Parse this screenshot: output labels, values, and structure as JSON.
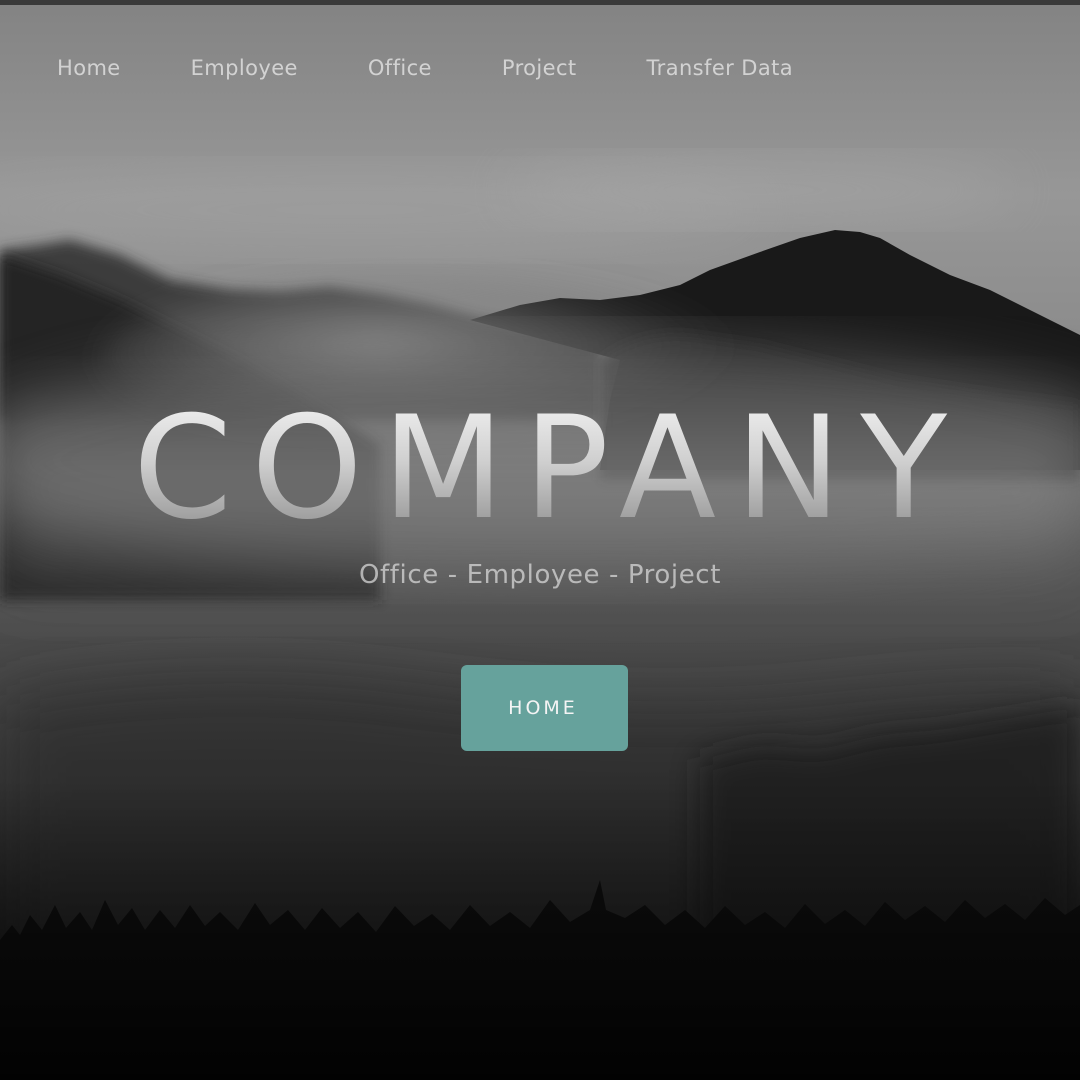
{
  "nav": {
    "items": [
      {
        "label": "Home"
      },
      {
        "label": "Employee"
      },
      {
        "label": "Office"
      },
      {
        "label": "Project"
      },
      {
        "label": "Transfer Data"
      }
    ]
  },
  "hero": {
    "title": "COMPANY",
    "subtitle": "Office - Employee - Project",
    "button_label": "HOME",
    "background": "foggy-mountain-forest-image"
  },
  "colors": {
    "accent": "#66a29c",
    "top_bar": "#3a3a3a"
  }
}
